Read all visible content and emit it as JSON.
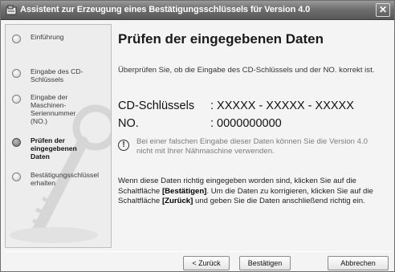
{
  "window": {
    "title": "Assistent zur Erzeugung eines Bestätigungsschlüssels für Version 4.0",
    "close_glyph": "✕"
  },
  "sidebar": {
    "steps": [
      {
        "label": "Einführung",
        "state": "inactive"
      },
      {
        "label": "Eingabe des CD-Schlüssels",
        "state": "inactive"
      },
      {
        "label": "Eingabe der Maschinen-Seriennummer (NO.)",
        "state": "inactive"
      },
      {
        "label": "Prüfen der eingegebenen Daten",
        "state": "active"
      },
      {
        "label": "Bestätigungsschlüssel erhalten",
        "state": "inactive"
      }
    ]
  },
  "main": {
    "title": "Prüfen der eingegebenen Daten",
    "intro": "Überprüfen Sie, ob die Eingabe des CD-Schlüssels und der NO. korrekt ist.",
    "cd_key_label": "CD-Schlüssels",
    "cd_key_value": ": XXXXX - XXXXX - XXXXX",
    "no_label": "NO.",
    "no_value": ": 0000000000",
    "warning_glyph": "!",
    "warning": "Bei einer falschen Eingabe dieser Daten können Sie die Version 4.0 nicht mit Ihrer Nähmaschine verwenden.",
    "body_part1": "Wenn diese Daten richtig eingegeben worden sind, klicken Sie auf die Schaltfläche ",
    "confirm_ref": "[Bestätigen]",
    "body_part2": ". Um die Daten zu korrigieren, klicken Sie auf die Schaltfläche ",
    "back_ref": "[Zurück]",
    "body_part3": " und geben Sie die Daten anschließend richtig ein."
  },
  "buttons": {
    "back": "< Zurück",
    "confirm": "Bestätigen",
    "cancel": "Abbrechen"
  },
  "colors": {
    "titlebar": "#6f6f6f",
    "active_step": "#505050",
    "warning_text": "#7c7c7c"
  }
}
